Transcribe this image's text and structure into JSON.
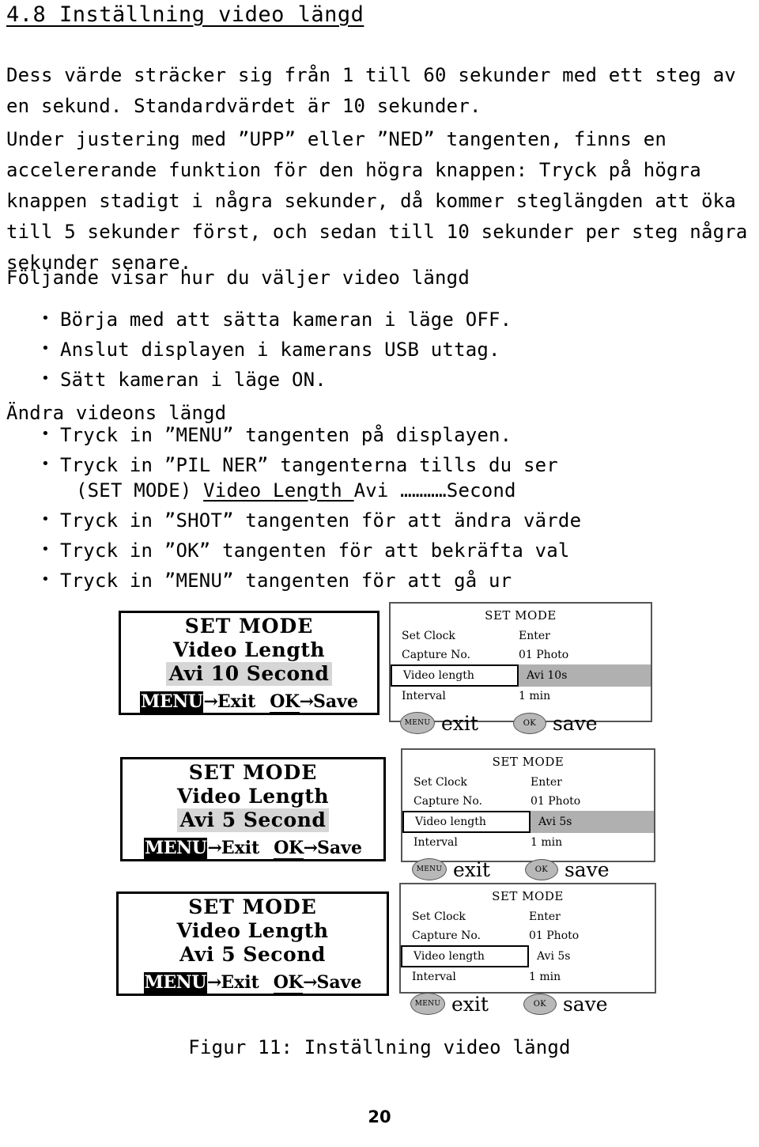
{
  "heading": "4.8 Inställning video längd",
  "paragraphs": {
    "p1": "Dess värde sträcker sig från 1 till 60 sekunder med ett steg av en sekund. Standardvärdet är 10 sekunder.",
    "p2": "Under justering med ”UPP” eller ”NED” tangenten, finns en accelererande funktion för den högra knappen: Tryck på högra knappen stadigt i några sekunder, då kommer steglängden att öka till 5 sekunder först, och sedan till 10 sekunder per steg några sekunder senare.",
    "p3": "Följande visar hur du väljer video längd"
  },
  "list_a": [
    "Börja med att sätta kameran i läge OFF.",
    "Anslut displayen i kamerans USB uttag.",
    "Sätt kameran i läge ON."
  ],
  "subheading": "Ändra videons längd",
  "list_b": {
    "item1": "Tryck in ”MENU” tangenten på displayen.",
    "item2_line1": "Tryck in ”PIL NER” tangenterna tills du ser",
    "item2_prefix": "(SET MODE) ",
    "item2_underlined": "Video Length ",
    "item2_suffix": "Avi …………Second",
    "item3": "Tryck in ”SHOT” tangenten för att ändra värde",
    "item4": "Tryck in ”OK” tangenten för att bekräfta val",
    "item5": "Tryck in ”MENU” tangenten för att gå ur"
  },
  "figure": {
    "caption": "Figur 11: Inställning video längd",
    "rows": [
      {
        "lcd": {
          "title": "SET MODE",
          "subtitle": "Video Length",
          "value": "Avi 10 Second",
          "value_highlighted": true,
          "key_menu": "MENU",
          "arrow": "→",
          "exit_label": "Exit",
          "key_ok": "OK",
          "save_label": "Save"
        },
        "menu": {
          "title": "SET MODE",
          "rows": [
            {
              "label": "Set Clock",
              "value": "Enter"
            },
            {
              "label": "Capture No.",
              "value": "01 Photo"
            },
            {
              "label": "Video length",
              "value": "Avi 10s",
              "selected": true,
              "value_highlighted": true
            },
            {
              "label": "Interval",
              "value": "1 min"
            }
          ],
          "btn_menu": "MENU",
          "exit_label": "exit",
          "btn_ok": "OK",
          "save_label": "save"
        }
      },
      {
        "lcd": {
          "title": "SET MODE",
          "subtitle": "Video Length",
          "value": "Avi 5 Second",
          "value_highlighted": true,
          "key_menu": "MENU",
          "arrow": "→",
          "exit_label": "Exit",
          "key_ok": "OK",
          "save_label": "Save"
        },
        "menu": {
          "title": "SET MODE",
          "rows": [
            {
              "label": "Set Clock",
              "value": "Enter"
            },
            {
              "label": "Capture No.",
              "value": "01 Photo"
            },
            {
              "label": "Video length",
              "value": "Avi 5s",
              "selected": true,
              "value_highlighted": true
            },
            {
              "label": "Interval",
              "value": "1 min"
            }
          ],
          "btn_menu": "MENU",
          "exit_label": "exit",
          "btn_ok": "OK",
          "save_label": "save"
        }
      },
      {
        "lcd": {
          "title": "SET MODE",
          "subtitle": "Video Length",
          "value": "Avi 5 Second",
          "value_highlighted": false,
          "key_menu": "MENU",
          "arrow": "→",
          "exit_label": "Exit",
          "key_ok": "OK",
          "save_label": "Save"
        },
        "menu": {
          "title": "SET MODE",
          "rows": [
            {
              "label": "Set Clock",
              "value": "Enter"
            },
            {
              "label": "Capture No.",
              "value": "01 Photo"
            },
            {
              "label": "Video length",
              "value": "Avi 5s",
              "selected": true,
              "value_highlighted": false
            },
            {
              "label": "Interval",
              "value": "1 min"
            }
          ],
          "btn_menu": "MENU",
          "exit_label": "exit",
          "btn_ok": "OK",
          "save_label": "save"
        }
      }
    ]
  },
  "page_number": "20"
}
